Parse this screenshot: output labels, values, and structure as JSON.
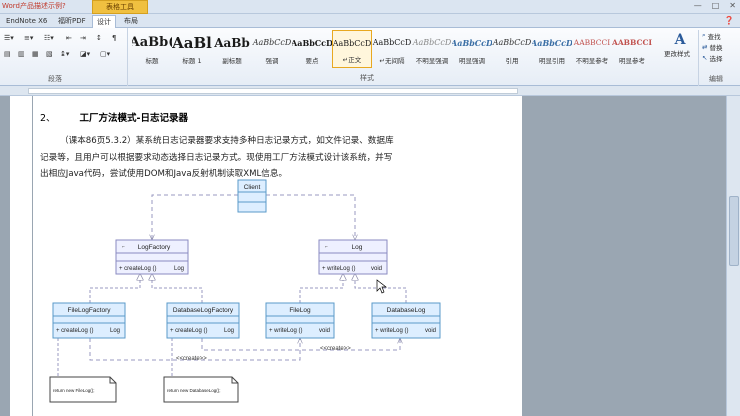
{
  "window": {
    "title": "Word产品描述示例?",
    "context_tab": "表格工具",
    "controls": [
      "—",
      "□",
      "✕"
    ]
  },
  "tabs": [
    {
      "label": "EndNote X6",
      "active": false
    },
    {
      "label": "福昕PDF",
      "active": false
    },
    {
      "label": "设计",
      "active": false
    },
    {
      "label": "布局",
      "active": false
    }
  ],
  "ribbon": {
    "paragraph_label": "段落",
    "styles_label": "样式",
    "editing_label": "编辑",
    "styles": [
      {
        "sample": "AaBb(",
        "name": "标题",
        "size": 13,
        "weight": "bold",
        "italic": false,
        "color": "#1a1a1a"
      },
      {
        "sample": "AaBl",
        "name": "标题 1",
        "size": 15,
        "weight": "bold",
        "italic": false,
        "color": "#1a1a1a"
      },
      {
        "sample": "AaBb",
        "name": "副标题",
        "size": 12,
        "weight": "bold",
        "italic": false,
        "color": "#1a1a1a"
      },
      {
        "sample": "AaBbCcD",
        "name": "强调",
        "size": 8,
        "weight": "normal",
        "italic": true,
        "color": "#333"
      },
      {
        "sample": "AaBbCcD",
        "name": "要点",
        "size": 8,
        "weight": "bold",
        "italic": false,
        "color": "#1a1a1a"
      },
      {
        "sample": "AaBbCcD",
        "name": "↵正文",
        "size": 8,
        "weight": "normal",
        "italic": false,
        "color": "#1a1a1a",
        "selected": true
      },
      {
        "sample": "AaBbCcD",
        "name": "↵无间隔",
        "size": 8,
        "weight": "normal",
        "italic": false,
        "color": "#1a1a1a"
      },
      {
        "sample": "AaBbCcD",
        "name": "不明显强调",
        "size": 8,
        "weight": "normal",
        "italic": true,
        "color": "#888"
      },
      {
        "sample": "AaBbCcD",
        "name": "明显强调",
        "size": 8,
        "weight": "bold",
        "italic": true,
        "color": "#3a6ea5"
      },
      {
        "sample": "AaBbCcD",
        "name": "引用",
        "size": 8,
        "weight": "normal",
        "italic": true,
        "color": "#333"
      },
      {
        "sample": "AaBbCcD",
        "name": "明显引用",
        "size": 8,
        "weight": "bold",
        "italic": true,
        "color": "#3a6ea5"
      },
      {
        "sample": "AABBCCI",
        "name": "不明显参考",
        "size": 7.5,
        "weight": "normal",
        "italic": false,
        "color": "#c0504d"
      },
      {
        "sample": "AABBCCI",
        "name": "明显参考",
        "size": 7.5,
        "weight": "bold",
        "italic": false,
        "color": "#c0504d"
      }
    ],
    "change_styles": "更改样式",
    "editing": [
      {
        "icon": "find-icon",
        "label": "查找"
      },
      {
        "icon": "replace-icon",
        "label": "替换"
      },
      {
        "icon": "select-icon",
        "label": "选择"
      }
    ]
  },
  "document": {
    "heading_number": "2、",
    "heading_text": "工厂方法模式-日志记录器",
    "paragraph_lines": [
      "（课本86页5.3.2）某系统日志记录器要求支持多种日志记录方式，如文件记录、数据库",
      "记录等，且用户可以根据要求动态选择日志记录方式。现使用工厂方法模式设计该系统，并写",
      "出相应Java代码，尝试使用DOM和Java反射机制读取XML信息。"
    ]
  },
  "diagram": {
    "client": "Client",
    "log_factory": {
      "name": "LogFactory",
      "op": "+ createLog ()",
      "ret": "Log"
    },
    "log": {
      "name": "Log",
      "op": "+ writeLog ()",
      "ret": "void"
    },
    "file_log_factory": {
      "name": "FileLogFactory",
      "op": "+ createLog ()",
      "ret": "Log"
    },
    "database_log_factory": {
      "name": "DatabaseLogFactory",
      "op": "+ createLog ()",
      "ret": "Log"
    },
    "file_log": {
      "name": "FileLog",
      "op": "+ writeLog ()",
      "ret": "void"
    },
    "database_log": {
      "name": "DatabaseLog",
      "op": "+ writeLog ()",
      "ret": "void"
    },
    "create_label_1": "<<create>>",
    "create_label_2": "<<create>>",
    "note_1": "return new FileLog();",
    "note_2": "return new DatabaseLog();"
  }
}
